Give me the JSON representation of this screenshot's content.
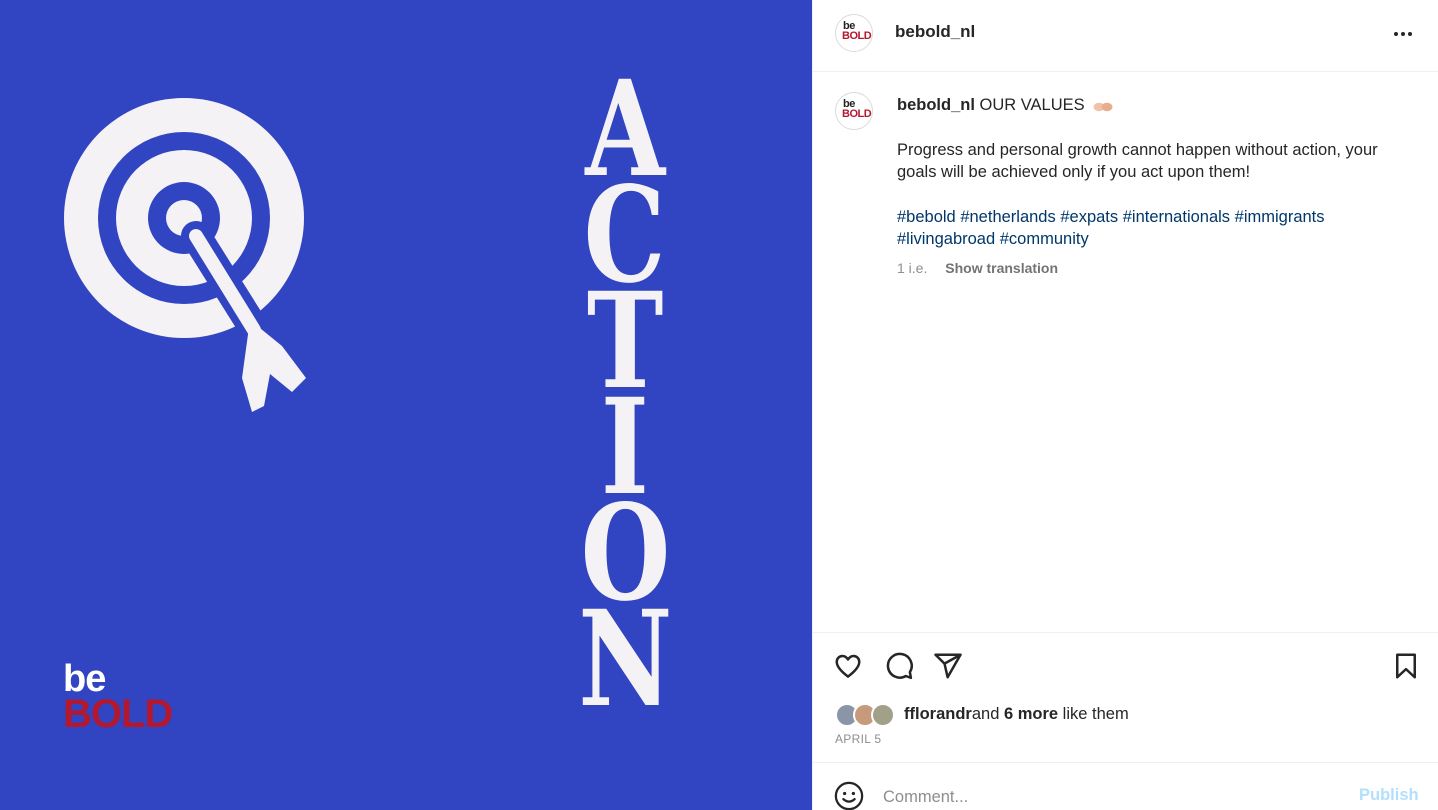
{
  "post": {
    "headline_word": [
      "A",
      "C",
      "T",
      "I",
      "O",
      "N"
    ],
    "brand_top": "be",
    "brand_bottom": "BOLD",
    "background_color": "#3144c1",
    "graphic_color": "#f4f2f4",
    "brand_red": "#b3182e"
  },
  "header": {
    "username": "bebold_nl",
    "avatar_top": "be",
    "avatar_bottom": "BOLD",
    "more_icon": "more-horizontal-icon"
  },
  "caption": {
    "username": "bebold_nl",
    "headline": "OUR VALUES",
    "emoji": "hands-emoji",
    "body": "Progress and personal growth cannot happen without action, your goals will be achieved only if you act upon them!",
    "hashtags": [
      "#bebold",
      "#netherlands",
      "#expats",
      "#internationals",
      "#immigrants",
      "#livingabroad",
      "#community"
    ],
    "time": "1 i.e.",
    "show_translation": "Show translation"
  },
  "actions": {
    "like_icon": "heart-icon",
    "comment_icon": "comment-icon",
    "share_icon": "send-icon",
    "save_icon": "bookmark-icon"
  },
  "likes": {
    "user": "fflorandr",
    "and_text": "and",
    "more_count": "6 more",
    "suffix": "like them",
    "date": "APRIL 5"
  },
  "comment": {
    "placeholder": "Comment...",
    "publish_label": "Publish"
  }
}
